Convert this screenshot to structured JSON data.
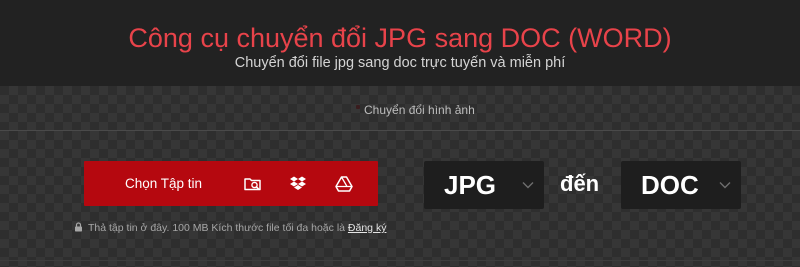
{
  "header": {
    "title": "Công cụ chuyển đổi JPG sang DOC (WORD)",
    "subtitle": "Chuyển đổi file jpg sang doc trực tuyến và miễn phí"
  },
  "nav": {
    "label": "Chuyển đổi hình ảnh"
  },
  "upload": {
    "button_label": "Chọn Tập tin",
    "icons": [
      "folder-search-icon",
      "dropbox-icon",
      "google-drive-icon"
    ]
  },
  "conversion": {
    "from_format": "JPG",
    "connector": "đến",
    "to_format": "DOC"
  },
  "note": {
    "text": "Thả tập tin ở đây. 100 MB Kích thước file tối đa hoặc là",
    "link": "Đăng ký"
  },
  "colors": {
    "accent": "#e8434a",
    "button": "#b5080f",
    "header_bg": "#222222",
    "select_bg": "#1e1e1e"
  }
}
